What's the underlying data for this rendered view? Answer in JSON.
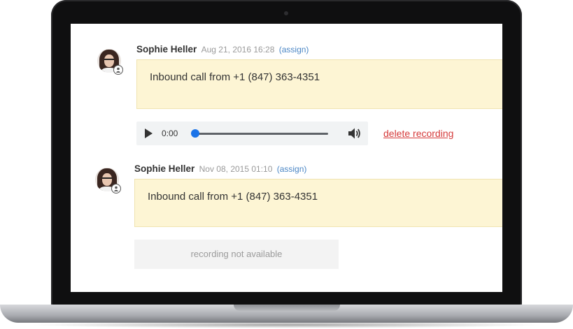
{
  "entries": [
    {
      "author": "Sophie Heller",
      "date": "Aug 21, 2016 16:28",
      "assign_label": "(assign)",
      "note": "Inbound call from +1 (847) 363-4351",
      "player": {
        "time": "0:00",
        "progress": 0
      },
      "delete_label": "delete recording"
    },
    {
      "author": "Sophie Heller",
      "date": "Nov 08, 2015 01:10",
      "assign_label": "(assign)",
      "note": "Inbound call from +1 (847) 363-4351",
      "unavailable_label": "recording not available"
    }
  ],
  "colors": {
    "note_bg": "#fdf5d4",
    "assign_link": "#4a86c5",
    "delete_link": "#d53a3a",
    "player_progress": "#1a73e8"
  },
  "icons": [
    "person-icon",
    "play-icon",
    "volume-icon"
  ]
}
